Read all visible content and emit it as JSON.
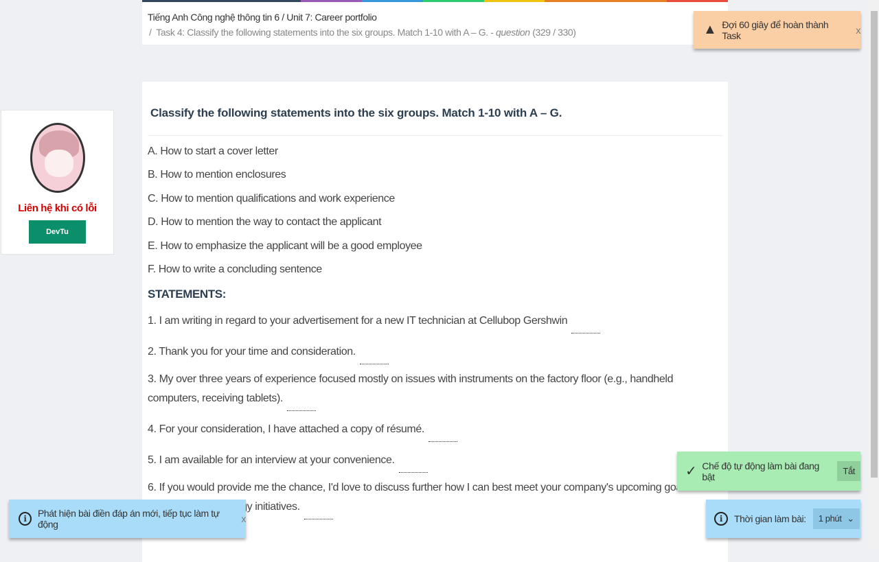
{
  "colors": {
    "bar": [
      "#34495e",
      "#9b59b6",
      "#3498db",
      "#2ecc71",
      "#f1c40f",
      "#e67e22",
      "#e67e22",
      "#e74c3c"
    ],
    "accent": "#0b8f6a",
    "error_text": "#d40000"
  },
  "breadcrumb": {
    "course": "Tiếng Anh Công nghệ thông tin 6",
    "sep": "/",
    "unit": "Unit 7: Career portfolio",
    "task": "Task 4: Classify the following statements into the six groups. Match 1-10 with A – G.",
    "type": "question",
    "progress": "(329 / 330)"
  },
  "sidebar": {
    "contact": "Liên hệ khi có lỗi",
    "button": "DevTu"
  },
  "question": {
    "title": "Classify the following statements into the six groups. Match 1-10 with A – G.",
    "options": [
      "A. How to start a cover letter",
      "B. How to mention enclosures",
      "C. How to mention qualifications and work experience",
      "D. How to mention the way to contact the applicant",
      "E. How to emphasize the applicant will be a good employee",
      "F. How to write a concluding sentence"
    ],
    "statements_heading": "STATEMENTS:",
    "statements": [
      "1. I am writing in regard to your advertisement for a new IT technician at Cellubop Gershwin",
      "2. Thank you for your time and consideration.",
      "3. My over three years of experience focused mostly on issues with instruments on the factory floor (e.g., handheld computers, receiving tablets).",
      "4. For your consideration, I have attached a copy of résumé.",
      "5. I am available for an interview at your convenience.",
      "6. If you would provide me the chance, I'd love to discuss further how I can best meet your company's upcoming goals and information technology initiatives."
    ]
  },
  "toasts": {
    "warn": "Đợi 60 giây để hoàn thành Task",
    "auto": "Chế độ tự động làm bài đang bật",
    "auto_off": "Tắt",
    "info": "Phát hiện bài điền đáp án mới, tiếp tục làm tự động",
    "time_label": "Thời gian làm bài:",
    "time_value": "1 phút",
    "close": "x"
  }
}
